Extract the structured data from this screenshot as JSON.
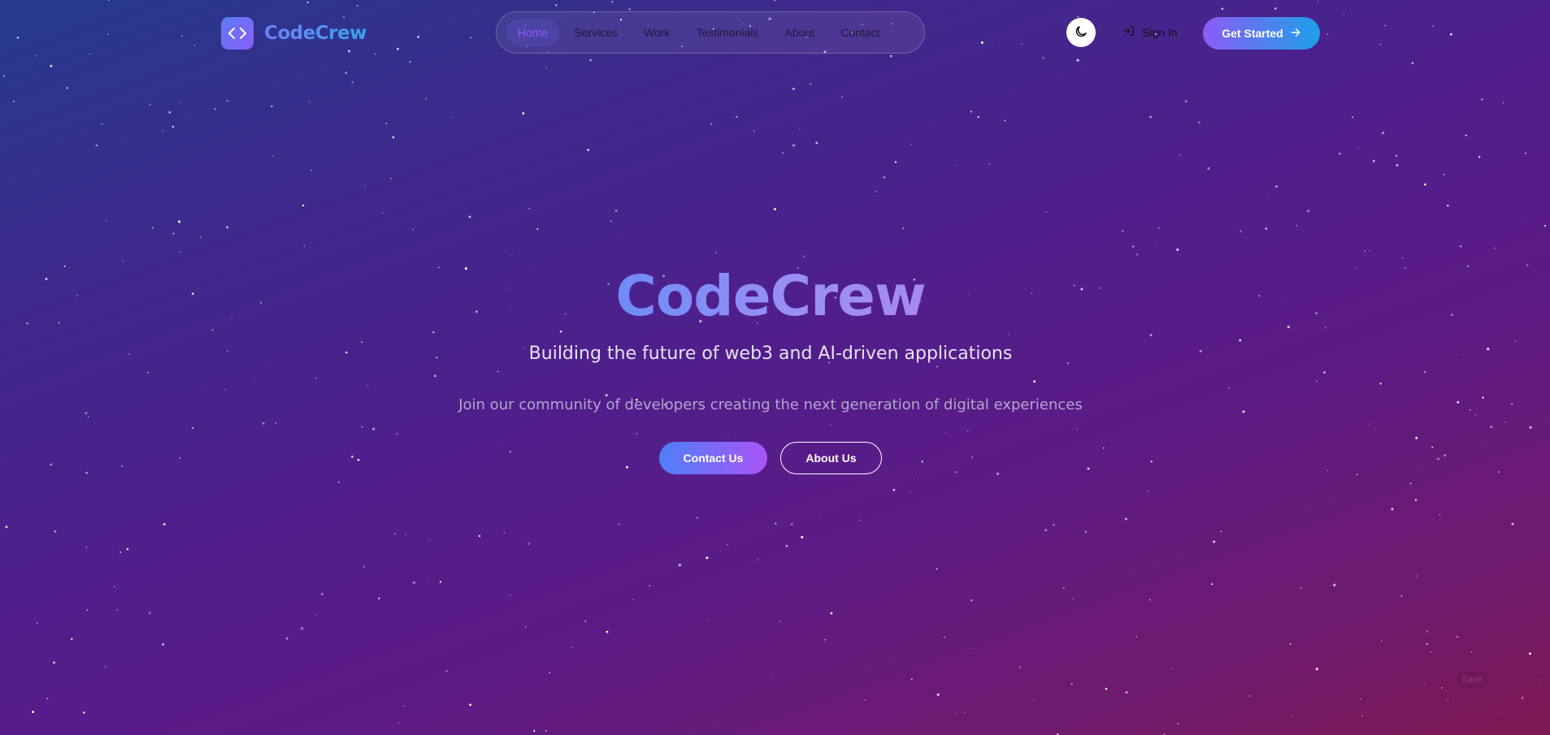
{
  "header": {
    "brand_name": "CodeCrew",
    "brand_icon": "code-brackets-icon",
    "nav": [
      {
        "label": "Home",
        "active": true
      },
      {
        "label": "Services",
        "active": false
      },
      {
        "label": "Work",
        "active": false
      },
      {
        "label": "Testimonials",
        "active": false
      },
      {
        "label": "About",
        "active": false
      },
      {
        "label": "Contact",
        "active": false
      }
    ],
    "theme_icon": "moon-icon",
    "sign_in_label": "Sign In",
    "sign_in_icon": "sign-in-icon",
    "cta_label": "Get Started",
    "cta_icon": "arrow-right-icon"
  },
  "hero": {
    "title": "CodeCrew",
    "subtitle": "Building the future of web3 and AI-driven applications",
    "description": "Join our community of developers creating the next generation of digital experiences",
    "primary_button": "Contact Us",
    "secondary_button": "About Us"
  },
  "save_label": "Save",
  "colors": {
    "accent": "#8b5cf6",
    "accent_blue": "#1ea0e8",
    "background_start": "#233a8a",
    "background_end": "#7d1852"
  }
}
